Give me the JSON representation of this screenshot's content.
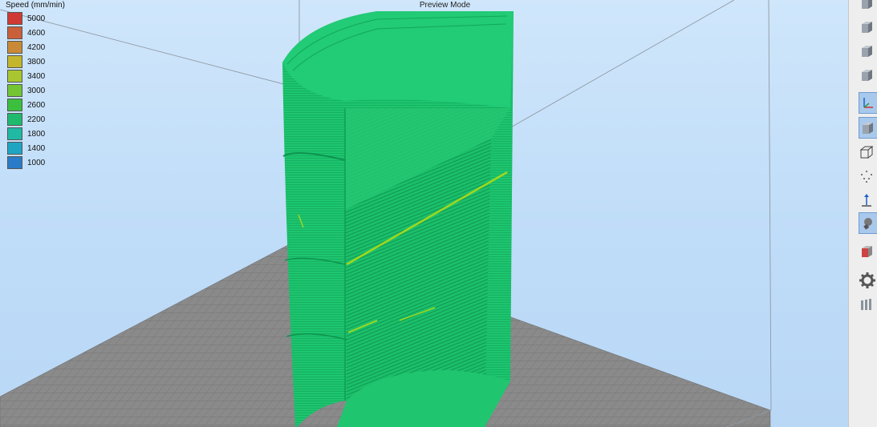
{
  "viewport": {
    "mode_label": "Preview Mode"
  },
  "legend": {
    "title": "Speed (mm/min)",
    "entries": [
      {
        "value": "5000",
        "color": "#d03a35"
      },
      {
        "value": "4600",
        "color": "#c9603a"
      },
      {
        "value": "4200",
        "color": "#c98a38"
      },
      {
        "value": "3800",
        "color": "#c3b62d"
      },
      {
        "value": "3400",
        "color": "#a9c631"
      },
      {
        "value": "3000",
        "color": "#74c534"
      },
      {
        "value": "2600",
        "color": "#3cbf3f"
      },
      {
        "value": "2200",
        "color": "#1fba6e"
      },
      {
        "value": "1800",
        "color": "#20b9a4"
      },
      {
        "value": "1400",
        "color": "#1fa5c2"
      },
      {
        "value": "1000",
        "color": "#2a7bc8"
      }
    ]
  },
  "model": {
    "print_color": "#19c46c",
    "line_color": "#0e8f4a",
    "highlight_color": "#9fd81e"
  },
  "toolbar": {
    "tools": [
      {
        "icon": "view-cube-front-icon",
        "active": false
      },
      {
        "icon": "view-cube-left-icon",
        "active": false
      },
      {
        "icon": "view-cube-right-icon",
        "active": false
      },
      {
        "icon": "view-cube-back-icon",
        "active": false
      },
      {
        "icon": "show-axes-icon",
        "active": true
      },
      {
        "icon": "solid-view-icon",
        "active": true
      },
      {
        "icon": "wireframe-view-icon",
        "active": false
      },
      {
        "icon": "point-cloud-icon",
        "active": false
      },
      {
        "icon": "show-normals-icon",
        "active": false
      },
      {
        "icon": "lighting-icon",
        "active": true
      },
      {
        "icon": "cross-section-icon",
        "active": false
      },
      {
        "icon": "settings-gear-icon",
        "active": false
      },
      {
        "icon": "layer-stack-icon",
        "active": false
      }
    ]
  }
}
